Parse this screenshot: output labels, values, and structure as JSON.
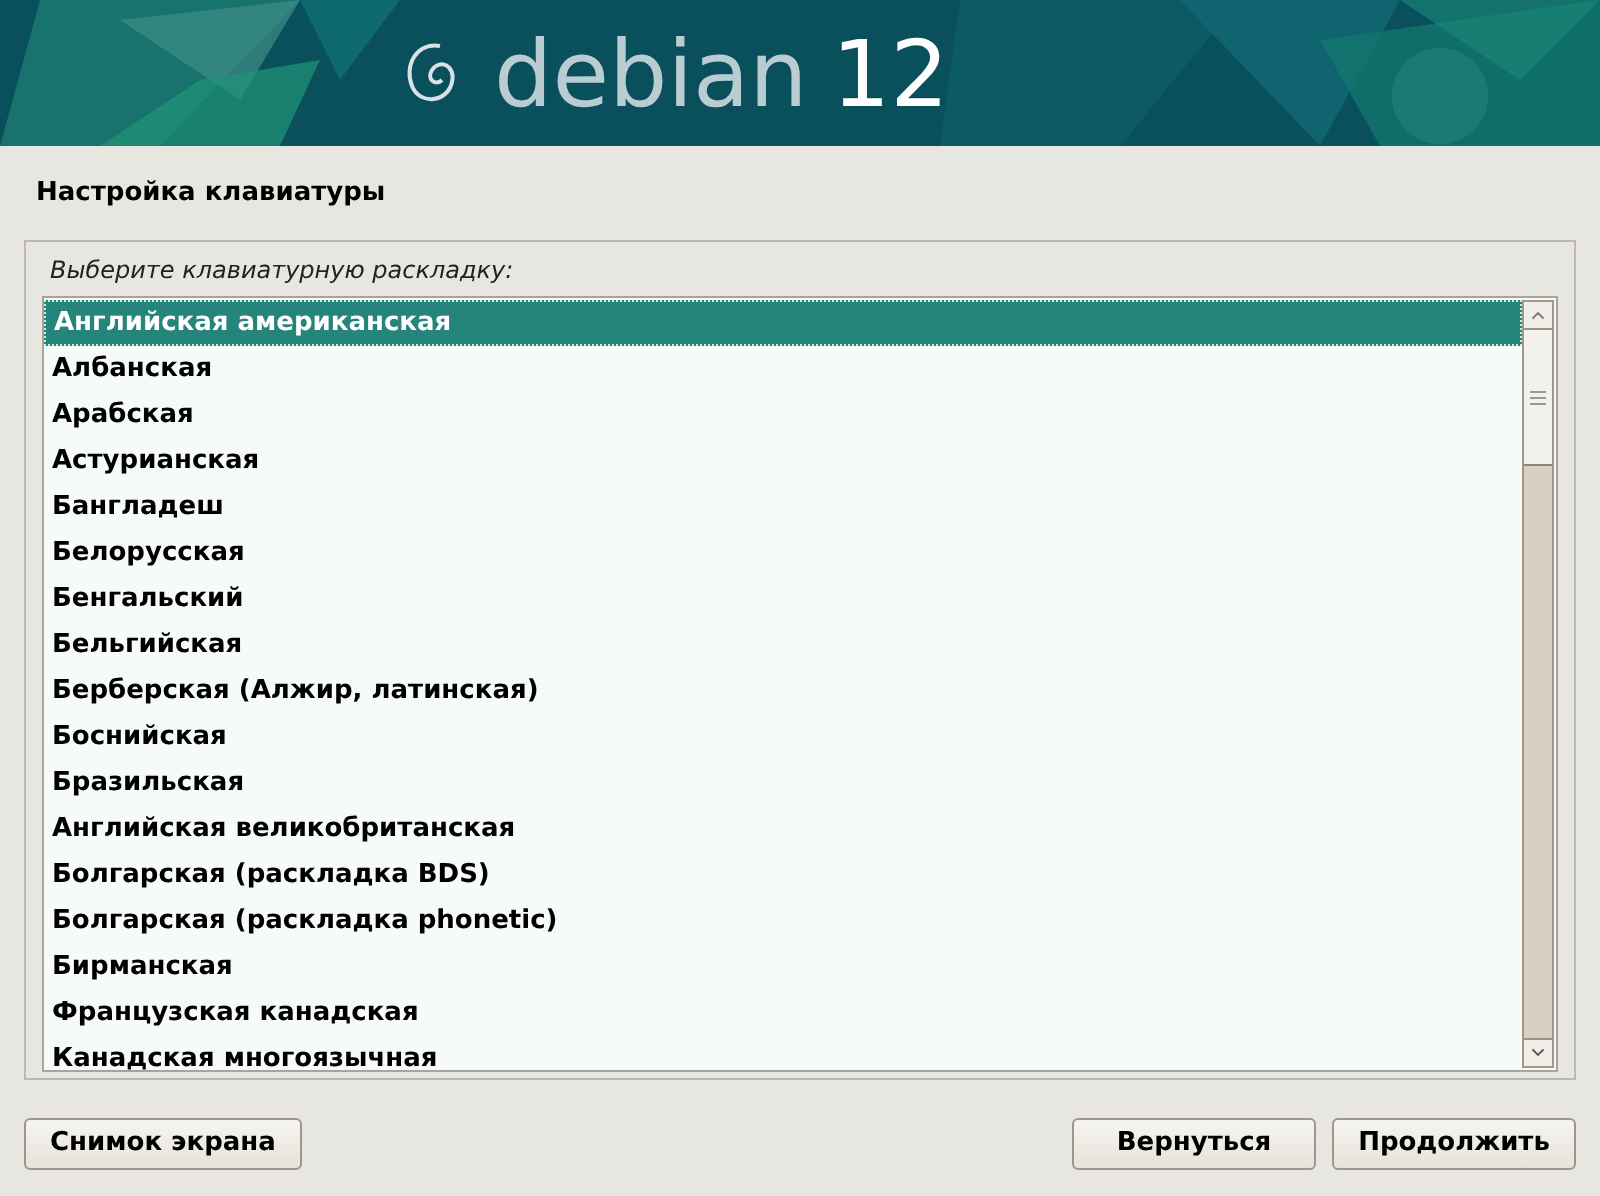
{
  "banner": {
    "logo_word": "debian",
    "logo_version": "12"
  },
  "title": "Настройка клавиатуры",
  "prompt": "Выберите клавиатурную раскладку:",
  "layouts": [
    {
      "label": "Английская американская",
      "selected": true
    },
    {
      "label": "Албанская",
      "selected": false
    },
    {
      "label": "Арабская",
      "selected": false
    },
    {
      "label": "Астурианская",
      "selected": false
    },
    {
      "label": "Бангладеш",
      "selected": false
    },
    {
      "label": "Белорусская",
      "selected": false
    },
    {
      "label": "Бенгальский",
      "selected": false
    },
    {
      "label": "Бельгийская",
      "selected": false
    },
    {
      "label": "Берберская (Алжир, латинская)",
      "selected": false
    },
    {
      "label": "Боснийская",
      "selected": false
    },
    {
      "label": "Бразильская",
      "selected": false
    },
    {
      "label": "Английская великобританская",
      "selected": false
    },
    {
      "label": "Болгарская (раскладка BDS)",
      "selected": false
    },
    {
      "label": "Болгарская (раскладка phonetic)",
      "selected": false
    },
    {
      "label": "Бирманская",
      "selected": false
    },
    {
      "label": "Французская канадская",
      "selected": false
    },
    {
      "label": "Канадская многоязычная",
      "selected": false
    }
  ],
  "buttons": {
    "left": [
      "Снимок экрана"
    ],
    "right": [
      "Вернуться",
      "Продолжить"
    ]
  }
}
